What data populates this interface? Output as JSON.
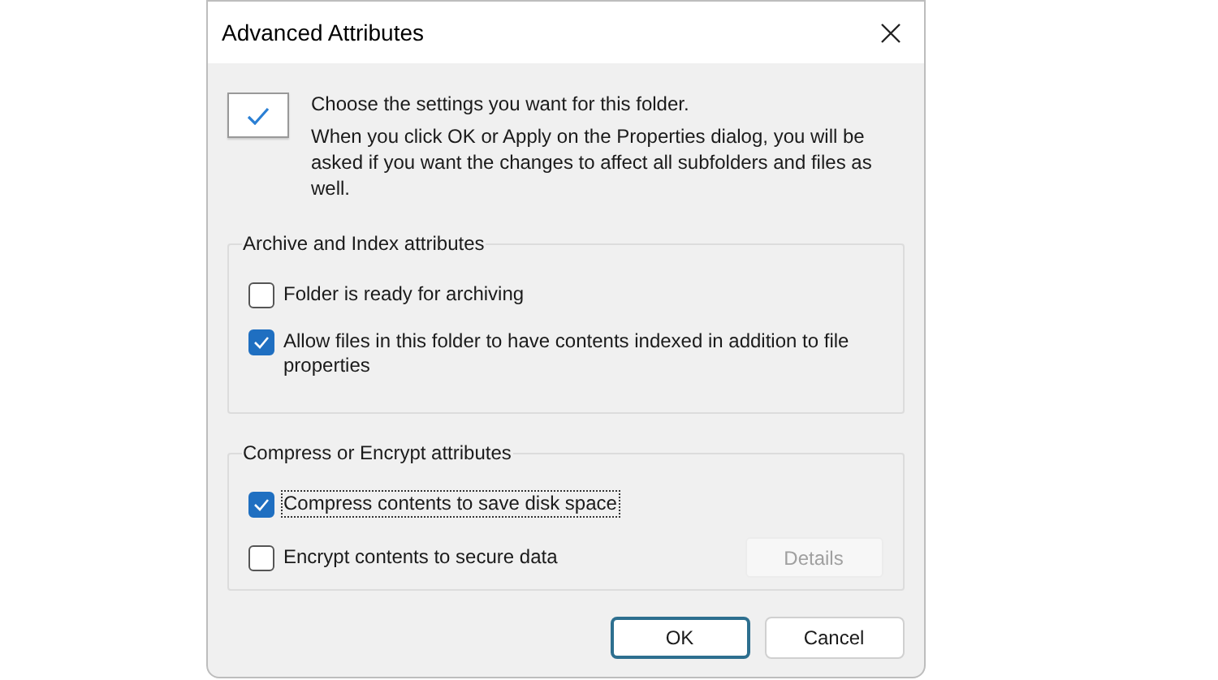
{
  "window": {
    "title": "Advanced Attributes"
  },
  "intro": {
    "heading": "Choose the settings you want for this folder.",
    "body": "When you click OK or Apply on the Properties dialog, you will be asked if you want the changes to affect all subfolders and files as well."
  },
  "groups": [
    {
      "title": "Archive and Index attributes",
      "items": [
        {
          "label": "Folder is ready for archiving",
          "checked": false,
          "focused": false
        },
        {
          "label": "Allow files in this folder to have contents indexed in addition to file properties",
          "checked": true,
          "focused": false
        }
      ]
    },
    {
      "title": "Compress or Encrypt attributes",
      "items": [
        {
          "label": "Compress contents to save disk space",
          "checked": true,
          "focused": true
        },
        {
          "label": "Encrypt contents to secure data",
          "checked": false,
          "focused": false
        }
      ],
      "button": {
        "label": "Details",
        "disabled": true
      }
    }
  ],
  "buttons": [
    {
      "label": "OK",
      "default": true
    },
    {
      "label": "Cancel",
      "default": false
    }
  ]
}
